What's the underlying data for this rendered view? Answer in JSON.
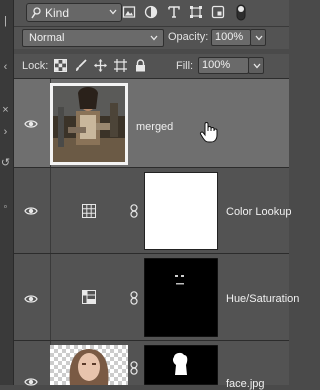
{
  "filter": {
    "kind_label": "Kind",
    "icons": [
      "image-filter-icon",
      "adjustment-filter-icon",
      "type-filter-icon",
      "shape-filter-icon",
      "smart-object-filter-icon",
      "filter-toggle-icon"
    ]
  },
  "blend": {
    "mode": "Normal",
    "opacity_label": "Opacity:",
    "opacity_value": "100%"
  },
  "lock": {
    "lock_label": "Lock:",
    "fill_label": "Fill:",
    "fill_value": "100%",
    "icons": [
      "lock-transparent-pixels-icon",
      "lock-image-pixels-icon",
      "lock-position-icon",
      "lock-artboard-icon",
      "lock-all-icon"
    ]
  },
  "layers": [
    {
      "name": "merged",
      "selected": true,
      "visible": true,
      "type": "pixel"
    },
    {
      "name": "Color Lookup",
      "selected": false,
      "visible": true,
      "type": "adjustment-color-lookup"
    },
    {
      "name": "Hue/Saturation",
      "selected": false,
      "visible": true,
      "type": "adjustment-hue-saturation"
    },
    {
      "name": "face.jpg",
      "selected": false,
      "visible": true,
      "type": "pixel-with-mask"
    }
  ],
  "colors": {
    "panel_bg": "#535353",
    "selected_bg": "#6f6f6f",
    "field_bg": "#6a6a6a"
  }
}
